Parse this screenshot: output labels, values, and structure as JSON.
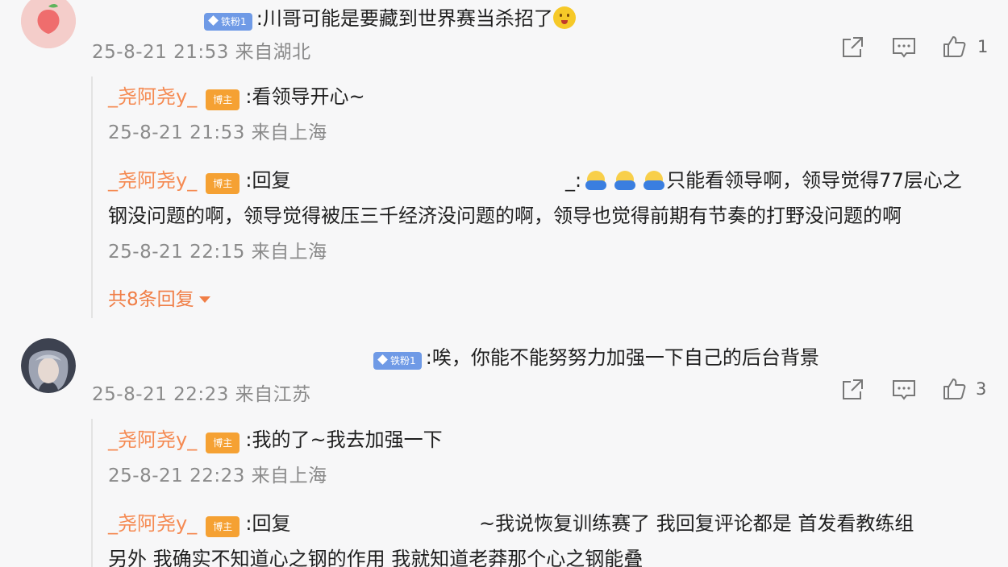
{
  "comments": [
    {
      "badge": "铁粉1",
      "text": ":川哥可能是要藏到世界赛当杀招了",
      "meta": "25-8-21 21:53 来自湖北",
      "likes": "1",
      "replies": [
        {
          "user": "_尧阿尧y_",
          "badge": "博主",
          "text": ":看领导开心~",
          "meta": "25-8-21 21:53 来自上海"
        },
        {
          "user": "_尧阿尧y_",
          "badge": "博主",
          "text_prefix": ":回复",
          "reply_to_tail": "_:",
          "text_line1": "只能看领导啊，领导觉得77层心之",
          "text_line2": "钢没问题的啊，领导觉得被压三千经济没问题的啊，领导也觉得前期有节奏的打野没问题的啊",
          "meta": "25-8-21 22:15 来自上海"
        }
      ],
      "more_replies": "共8条回复"
    },
    {
      "badge": "铁粉1",
      "text": ":唉，你能不能努努力加强一下自己的后台背景",
      "meta": "25-8-21 22:23 来自江苏",
      "likes": "3",
      "replies": [
        {
          "user": "_尧阿尧y_",
          "badge": "博主",
          "text": ":我的了~我去加强一下",
          "meta": "25-8-21 22:23 来自上海"
        },
        {
          "user": "_尧阿尧y_",
          "badge": "博主",
          "text_prefix": ":回复",
          "reply_to_tail": "~",
          "text_line1": "我说恢复训练赛了  我回复评论都是  首发看教练组",
          "text_line2": "另外  我确实不知道心之钢的作用  我就知道老莽那个心之钢能叠"
        }
      ]
    }
  ],
  "icons": [
    "share-icon",
    "comment-icon",
    "like-icon",
    "smile-emoji-icon",
    "cover-face-emoji-icon"
  ],
  "colors": {
    "username": "#f58a52",
    "host_badge": "#f5a133",
    "fan_badge": "#6f9ae6",
    "meta": "#8a8a8a"
  }
}
